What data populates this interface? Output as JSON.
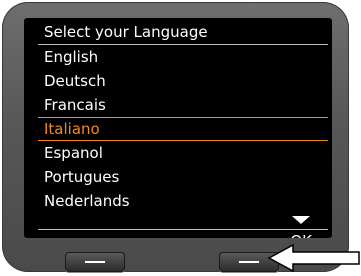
{
  "screen": {
    "title": "Select your Language",
    "languages": [
      {
        "label": "English",
        "selected": false
      },
      {
        "label": "Deutsch",
        "selected": false
      },
      {
        "label": "Francais",
        "selected": false
      },
      {
        "label": "Italiano",
        "selected": true
      },
      {
        "label": "Espanol",
        "selected": false
      },
      {
        "label": "Portugues",
        "selected": false
      },
      {
        "label": "Nederlands",
        "selected": false
      }
    ],
    "right_softkey_label": "OK"
  },
  "icons": {
    "scroll_indicator": "scroll-down-arrow-icon",
    "callout": "pointer-arrow-icon"
  },
  "colors": {
    "screen_background": "#000000",
    "text": "#ffffff",
    "highlight": "#f28a1a",
    "device_body": "#5a5a5a"
  }
}
